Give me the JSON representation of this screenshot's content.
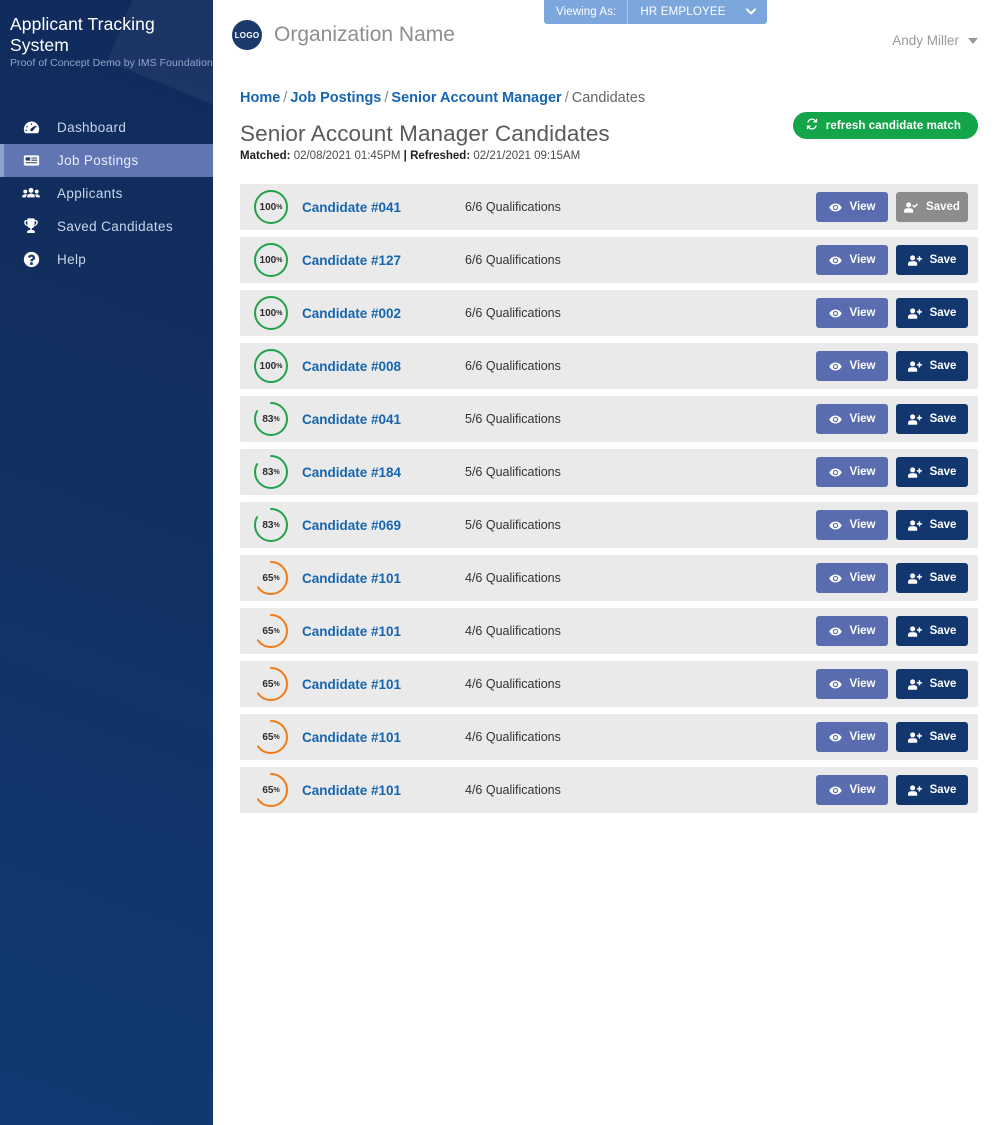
{
  "sidebar": {
    "brand_title": "Applicant Tracking System",
    "brand_subtitle": "Proof of Concept Demo by IMS Foundation",
    "items": [
      {
        "label": "Dashboard",
        "icon": "dashboard-icon",
        "active": false
      },
      {
        "label": "Job Postings",
        "icon": "job-postings-icon",
        "active": true
      },
      {
        "label": "Applicants",
        "icon": "applicants-icon",
        "active": false
      },
      {
        "label": "Saved Candidates",
        "icon": "trophy-icon",
        "active": false
      },
      {
        "label": "Help",
        "icon": "help-icon",
        "active": false
      }
    ]
  },
  "viewing_as": {
    "label": "Viewing As:",
    "value": "HR EMPLOYEE",
    "chevron": "❯",
    "bg_color": "#7ba7dd"
  },
  "header": {
    "logo_text": "LOGO",
    "organization_name": "Organization Name",
    "user_name": "Andy Miller",
    "user_chevron": "▾"
  },
  "breadcrumb": {
    "items": [
      {
        "label": "Home",
        "link": true
      },
      {
        "label": "Job Postings",
        "link": true
      },
      {
        "label": "Senior Account Manager",
        "link": true
      },
      {
        "label": "Candidates",
        "link": false
      }
    ],
    "separator": "/"
  },
  "page": {
    "title": "Senior Account Manager Candidates",
    "matched_label": "Matched:",
    "matched_value": "02/08/2021  01:45PM",
    "meta_divider": "|",
    "refreshed_label": "Refreshed:",
    "refreshed_value": "02/21/2021  09:15AM",
    "refresh_button_label": "refresh candidate match",
    "refresh_button_color": "#14a44a"
  },
  "buttons": {
    "view_label": "View",
    "save_label": "Save",
    "saved_label": "Saved",
    "view_color": "#5a6cb0",
    "save_color": "#12366e",
    "saved_color": "#8c8c8c"
  },
  "ring_colors": {
    "high": "#22a24a",
    "medium": "#f07c18",
    "track": "#eaeaea"
  },
  "candidates": [
    {
      "percent": 100,
      "percent_label": "100",
      "percent_symbol": "%",
      "name": "Candidate #041",
      "qualifications": "6/6 Qualifications",
      "color": "#22a24a",
      "saved": true
    },
    {
      "percent": 100,
      "percent_label": "100",
      "percent_symbol": "%",
      "name": "Candidate #127",
      "qualifications": "6/6 Qualifications",
      "color": "#22a24a",
      "saved": false
    },
    {
      "percent": 100,
      "percent_label": "100",
      "percent_symbol": "%",
      "name": "Candidate #002",
      "qualifications": "6/6 Qualifications",
      "color": "#22a24a",
      "saved": false
    },
    {
      "percent": 100,
      "percent_label": "100",
      "percent_symbol": "%",
      "name": "Candidate #008",
      "qualifications": "6/6 Qualifications",
      "color": "#22a24a",
      "saved": false
    },
    {
      "percent": 83,
      "percent_label": "83",
      "percent_symbol": "%",
      "name": "Candidate #041",
      "qualifications": "5/6 Qualifications",
      "color": "#22a24a",
      "saved": false
    },
    {
      "percent": 83,
      "percent_label": "83",
      "percent_symbol": "%",
      "name": "Candidate #184",
      "qualifications": "5/6 Qualifications",
      "color": "#22a24a",
      "saved": false
    },
    {
      "percent": 83,
      "percent_label": "83",
      "percent_symbol": "%",
      "name": "Candidate #069",
      "qualifications": "5/6 Qualifications",
      "color": "#22a24a",
      "saved": false
    },
    {
      "percent": 65,
      "percent_label": "65",
      "percent_symbol": "%",
      "name": "Candidate #101",
      "qualifications": "4/6 Qualifications",
      "color": "#f07c18",
      "saved": false
    },
    {
      "percent": 65,
      "percent_label": "65",
      "percent_symbol": "%",
      "name": "Candidate #101",
      "qualifications": "4/6 Qualifications",
      "color": "#f07c18",
      "saved": false
    },
    {
      "percent": 65,
      "percent_label": "65",
      "percent_symbol": "%",
      "name": "Candidate #101",
      "qualifications": "4/6 Qualifications",
      "color": "#f07c18",
      "saved": false
    },
    {
      "percent": 65,
      "percent_label": "65",
      "percent_symbol": "%",
      "name": "Candidate #101",
      "qualifications": "4/6 Qualifications",
      "color": "#f07c18",
      "saved": false
    },
    {
      "percent": 65,
      "percent_label": "65",
      "percent_symbol": "%",
      "name": "Candidate #101",
      "qualifications": "4/6 Qualifications",
      "color": "#f07c18",
      "saved": false
    }
  ]
}
